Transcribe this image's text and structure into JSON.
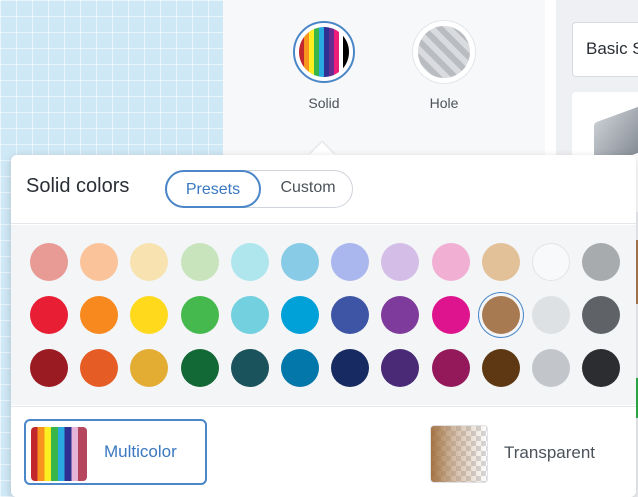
{
  "inspector": {
    "solid_label": "Solid",
    "hole_label": "Hole"
  },
  "shapes_panel": {
    "search_label": "Basic S"
  },
  "popup": {
    "title": "Solid colors",
    "tabs": {
      "presets": "Presets",
      "custom": "Custom"
    },
    "selected_tab": "Presets",
    "swatches": [
      [
        "#e89a94",
        "#fac39a",
        "#f7e2b0",
        "#c8e4bc",
        "#afe6ee",
        "#88cbe6",
        "#aab7ee",
        "#d4bde6",
        "#f1b0d3",
        "#e2c198",
        "#f8f9fa",
        "#a8abae"
      ],
      [
        "#e81e35",
        "#f7891e",
        "#ffd91c",
        "#45b94d",
        "#73d0df",
        "#00a0d8",
        "#3e54a4",
        "#7e3b9b",
        "#de138e",
        "#a87a52",
        "#dee1e3",
        "#5f6368"
      ],
      [
        "#9b1b22",
        "#e65c25",
        "#e3ad33",
        "#136936",
        "#1a535c",
        "#0376aa",
        "#172b62",
        "#4a2a76",
        "#93195a",
        "#5d3812",
        "#c2c6ca",
        "#2b2d30"
      ]
    ],
    "selected_color": "#a87a52",
    "multicolor_label": "Multicolor",
    "transparent_label": "Transparent"
  }
}
